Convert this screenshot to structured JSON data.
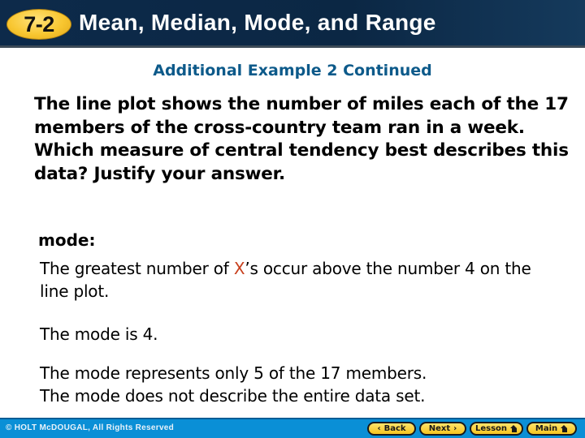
{
  "header": {
    "badge": "7-2",
    "title": "Mean, Median, Mode, and Range"
  },
  "subtitle": "Additional Example 2 Continued",
  "question": "The line plot shows the number of miles each of the 17 members of the cross-country team ran in a week. Which measure of central tendency best describes this data? Justify your answer.",
  "answer": {
    "label": "mode:",
    "p1_before": "The greatest number of ",
    "p1_x": "X",
    "p1_after": "’s occur above the number 4 on the line plot.",
    "p2": "The mode is 4.",
    "p3_line1": "The mode represents only 5 of the 17 members.",
    "p3_line2": "The mode does not describe the entire data set."
  },
  "footer": {
    "copyright": "© HOLT McDOUGAL, All Rights Reserved",
    "nav": {
      "back": "Back",
      "next": "Next",
      "lesson": "Lesson",
      "main": "Main",
      "back_glyph": "‹",
      "next_glyph": "›"
    }
  },
  "colors": {
    "header_bg": "#0d2a4a",
    "badge": "#f8c630",
    "subtitle": "#0d5a8a",
    "highlight_x": "#c8401e",
    "footer_bg": "#0a8fd6",
    "nav_button": "#f5c51f"
  }
}
